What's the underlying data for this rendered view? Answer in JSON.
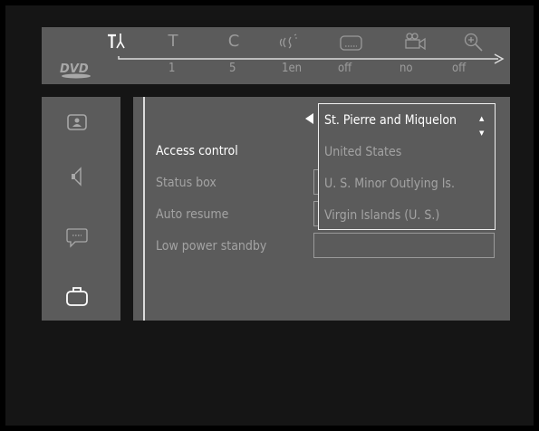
{
  "top_bar": {
    "icons": [
      {
        "name": "settings-tools-icon",
        "active": true
      },
      {
        "name": "title-icon",
        "active": false
      },
      {
        "name": "chapter-icon",
        "active": false
      },
      {
        "name": "audio-icon",
        "active": false
      },
      {
        "name": "subtitle-icon",
        "active": false
      },
      {
        "name": "camera-angle-icon",
        "active": false
      },
      {
        "name": "zoom-icon",
        "active": false
      }
    ],
    "glyphs": {
      "title": "T",
      "chapter": "C"
    },
    "values": {
      "title": "1",
      "chapter": "5",
      "audio": "1en",
      "subtitle": "off",
      "angle": "no",
      "zoom": "off"
    },
    "logo": "DVD"
  },
  "sidebar": {
    "items": [
      {
        "name": "picture-icon",
        "active": false
      },
      {
        "name": "sound-icon",
        "active": false
      },
      {
        "name": "language-icon",
        "active": false
      },
      {
        "name": "features-icon",
        "active": true
      }
    ]
  },
  "menu": {
    "items": [
      {
        "label": "Access control",
        "selected": true
      },
      {
        "label": "Status box",
        "selected": false
      },
      {
        "label": "Auto resume",
        "selected": false
      },
      {
        "label": "Low power standby",
        "selected": false
      }
    ]
  },
  "dropdown": {
    "options": [
      {
        "label": "St. Pierre and Miquelon",
        "selected": true
      },
      {
        "label": "United States",
        "selected": false
      },
      {
        "label": "U. S. Minor Outlying Is.",
        "selected": false
      },
      {
        "label": "Virgin Islands (U. S.)",
        "selected": false
      }
    ],
    "scroll_up": "▲",
    "scroll_down": "▼"
  },
  "colors": {
    "panel": "#5b5b5b",
    "text_active": "#ffffff",
    "text_inactive": "#a3a3a3",
    "background": "#151515"
  }
}
